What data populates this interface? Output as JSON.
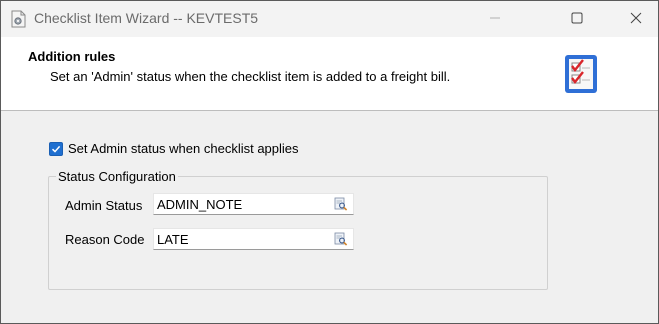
{
  "window": {
    "title": "Checklist Item Wizard -- KEVTEST5",
    "icons": {
      "app": "wizard-app-icon",
      "minimize": "minimize-icon",
      "maximize": "maximize-icon",
      "close": "close-icon"
    }
  },
  "header": {
    "title": "Addition rules",
    "description": "Set an 'Admin' status when the checklist item is added to a freight bill.",
    "icon": "checklist-icon"
  },
  "options": {
    "set_admin_status": {
      "label": "Set Admin status when checklist applies",
      "checked": true
    }
  },
  "status_configuration": {
    "title": "Status Configuration",
    "fields": [
      {
        "label": "Admin Status",
        "value": "ADMIN_NOTE",
        "button_icon": "lookup-icon"
      },
      {
        "label": "Reason Code",
        "value": "LATE",
        "button_icon": "lookup-icon"
      }
    ]
  },
  "colors": {
    "accent": "#1f6fd0",
    "checklist_red": "#d9262b",
    "checklist_blue": "#2f6fd6"
  }
}
